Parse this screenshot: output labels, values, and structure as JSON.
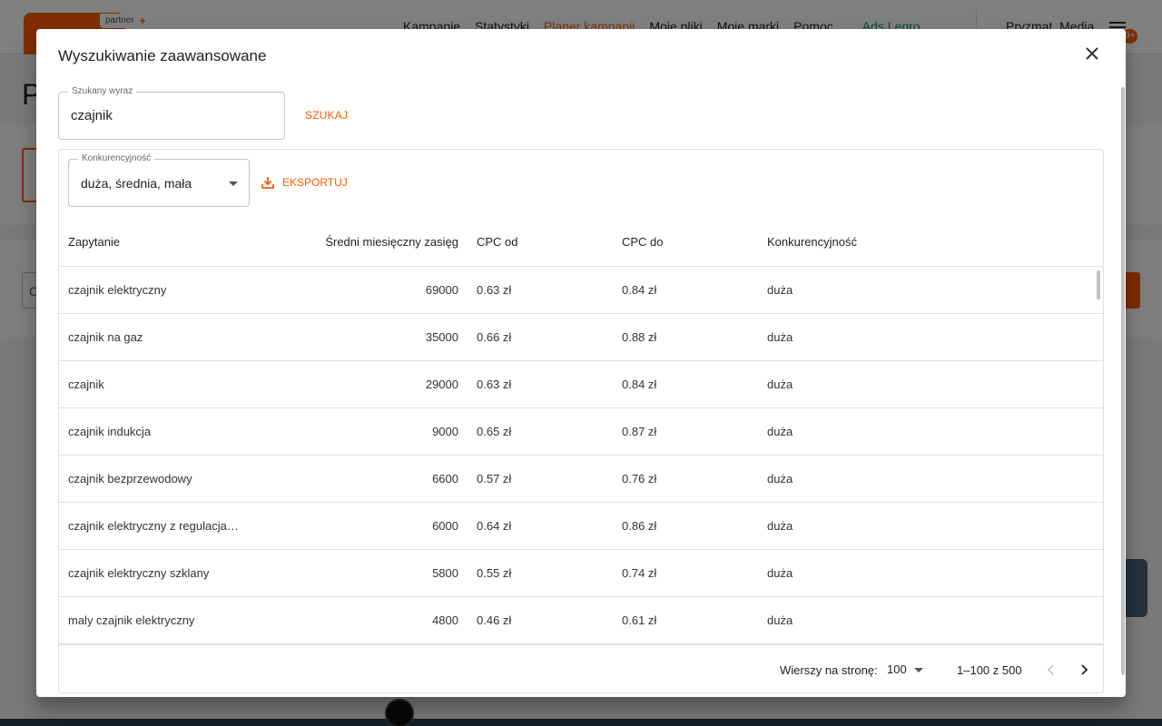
{
  "app": {
    "logo_badge": "partner",
    "nav": [
      "Kampanie",
      "Statystyki",
      "Planer kampanii",
      "Moje pliki",
      "Moje marki",
      "Pomoc"
    ],
    "ads_link": "Ads.Legro",
    "user_name": "Pryzmat_Media",
    "notification_count": "9+",
    "page_heading_partial": "P",
    "input_partial": "C"
  },
  "dialog": {
    "title": "Wyszukiwanie zaawansowane",
    "search": {
      "label": "Szukany wyraz",
      "value": "czajnik",
      "button": "SZUKAJ"
    },
    "filter": {
      "label": "Konkurencyjność",
      "value": "duża, średnia, mała"
    },
    "export_button": "EKSPORTUJ",
    "table": {
      "headers": {
        "query": "Zapytanie",
        "reach": "Średni miesięczny zasięg",
        "cpc_from": "CPC od",
        "cpc_to": "CPC do",
        "competition": "Konkurencyjność"
      },
      "rows": [
        {
          "query": "czajnik elektryczny",
          "reach": "69000",
          "cpc_from": "0.63 zł",
          "cpc_to": "0.84 zł",
          "competition": "duża"
        },
        {
          "query": "czajnik na gaz",
          "reach": "35000",
          "cpc_from": "0.66 zł",
          "cpc_to": "0.88 zł",
          "competition": "duża"
        },
        {
          "query": "czajnik",
          "reach": "29000",
          "cpc_from": "0.63 zł",
          "cpc_to": "0.84 zł",
          "competition": "duża"
        },
        {
          "query": "czajnik indukcja",
          "reach": "9000",
          "cpc_from": "0.65 zł",
          "cpc_to": "0.87 zł",
          "competition": "duża"
        },
        {
          "query": "czajnik bezprzewodowy",
          "reach": "6600",
          "cpc_from": "0.57 zł",
          "cpc_to": "0.76 zł",
          "competition": "duża"
        },
        {
          "query": "czajnik elektryczny z regulacja te...",
          "reach": "6000",
          "cpc_from": "0.64 zł",
          "cpc_to": "0.86 zł",
          "competition": "duża"
        },
        {
          "query": "czajnik elektryczny szklany",
          "reach": "5800",
          "cpc_from": "0.55 zł",
          "cpc_to": "0.74 zł",
          "competition": "duża"
        },
        {
          "query": "maly czajnik elektryczny",
          "reach": "4800",
          "cpc_from": "0.46 zł",
          "cpc_to": "0.61 zł",
          "competition": "duża"
        }
      ]
    },
    "pagination": {
      "rows_per_page_label": "Wierszy na stronę:",
      "rows_per_page": "100",
      "range": "1–100 z 500"
    }
  },
  "colors": {
    "accent": "#ff5a00",
    "overlay": "rgba(0,0,0,0.5)",
    "ads_link": "#1a8a4a"
  }
}
